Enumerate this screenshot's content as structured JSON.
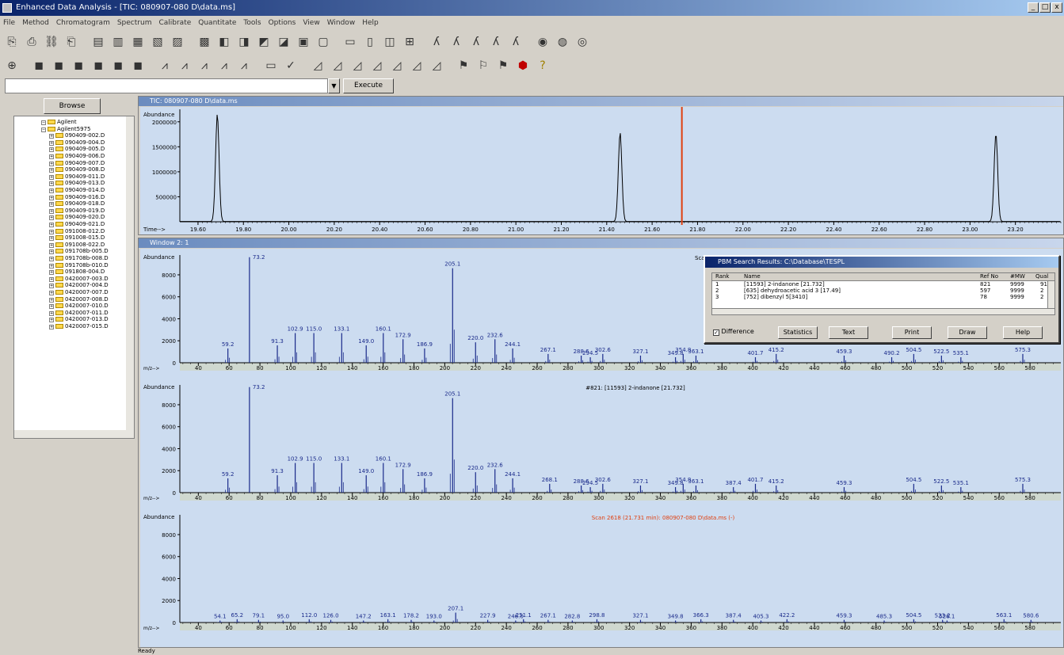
{
  "window": {
    "title": "Enhanced Data Analysis - [TIC: 080907-080 D\\data.ms]",
    "controls": [
      "_",
      "□",
      "x"
    ]
  },
  "menu": [
    "File",
    "Method",
    "Chromatogram",
    "Spectrum",
    "Calibrate",
    "Quantitate",
    "Tools",
    "Options",
    "View",
    "Window",
    "Help"
  ],
  "toolbar1_icons": [
    "load-icon",
    "save-icon",
    "link-icon",
    "print-icon",
    "chrom-icon",
    "spec-icon",
    "integrate-icon",
    "library-icon",
    "tune-icon",
    "report-icon",
    "peak-icon",
    "calib-icon",
    "qual-icon",
    "quant-icon",
    "table-icon",
    "doc-icon",
    "signal-icon",
    "window-icon",
    "overlay-icon",
    "zoom-icon",
    "a1-icon",
    "a2-icon",
    "a3-icon",
    "a4-icon",
    "a5-icon",
    "sync-icon",
    "globe-icon",
    "network-icon"
  ],
  "toolbar2_icons": [
    "target-icon",
    "b1-icon",
    "b2-icon",
    "b3-icon",
    "b4-icon",
    "b5-icon",
    "b6-icon",
    "scale1-icon",
    "scale2-icon",
    "peak1-icon",
    "peak2-icon",
    "peak3-icon",
    "frame-icon",
    "check-icon",
    "chart1-icon",
    "chart2-icon",
    "chart3-icon",
    "chart4-icon",
    "chart5-icon",
    "chart6-icon",
    "chart7-icon",
    "flag-icon",
    "flag2-icon",
    "flag3-icon",
    "stop-icon",
    "help-icon"
  ],
  "command": {
    "value": "",
    "execute": "Execute"
  },
  "browse": {
    "label": "Browse"
  },
  "tree": {
    "items": [
      "Agilent",
      "Agilent5975",
      "090409-002.D",
      "090409-004.D",
      "090409-005.D",
      "090409-006.D",
      "090409-007.D",
      "090409-008.D",
      "090409-011.D",
      "090409-013.D",
      "090409-014.D",
      "090409-016.D",
      "090409-018.D",
      "090409-019.D",
      "090409-020.D",
      "090409-021.D",
      "091008-012.D",
      "091008-015.D",
      "091008-022.D",
      "091708b-005.D",
      "091708b-008.D",
      "091708b-010.D",
      "091808-004.D",
      "0420007-003.D",
      "0420007-004.D",
      "0420007-007.D",
      "0420007-008.D",
      "0420007-010.D",
      "0420007-011.D",
      "0420007-013.D",
      "0420007-015.D"
    ]
  },
  "tic_window": {
    "title": "TIC: 080907-080 D\\data.ms"
  },
  "tic": {
    "ylabel": "Abundance",
    "xlabel": "Time-->",
    "ytick_labels": [
      "2000000",
      "1500000",
      "1000000",
      "500000"
    ],
    "xtick_labels": [
      "19.60",
      "19.80",
      "20.00",
      "20.20",
      "20.40",
      "20.60",
      "20.80",
      "21.00",
      "21.20",
      "21.40",
      "21.60",
      "21.80",
      "22.00",
      "22.20",
      "22.40",
      "22.60",
      "22.80",
      "23.00",
      "23.20"
    ],
    "marker_color": "#e04010"
  },
  "spec_window": {
    "title": "Window 2: 1"
  },
  "spectra": [
    {
      "ylabel": "Abundance",
      "xlabel": "m/z-->",
      "header": "Scan 2598 (21.731 min): 080907-080 D\\data.ms",
      "header_color": "#000000",
      "base_peak_label": "73.2",
      "labels": [
        "59.2",
        "91.3",
        "102.9",
        "115.0",
        "133.1",
        "149.0",
        "160.1",
        "172.9",
        "186.9",
        "205.1",
        "220.0",
        "232.6",
        "244.1",
        "267.1",
        "288.6",
        "294.5",
        "302.6",
        "327.1",
        "349.8",
        "354.8",
        "363.1",
        "401.7",
        "415.2",
        "459.3",
        "490.2",
        "504.5",
        "522.5",
        "535.1",
        "575.3"
      ]
    },
    {
      "ylabel": "Abundance",
      "xlabel": "m/z-->",
      "header": "#821: [11593] 2-indanone [21.732]",
      "header_color": "#000000",
      "base_peak_label": "73.2",
      "labels": [
        "59.2",
        "91.3",
        "102.9",
        "115.0",
        "133.1",
        "149.0",
        "160.1",
        "172.9",
        "186.9",
        "205.1",
        "220.0",
        "232.6",
        "244.1",
        "268.1",
        "288.6",
        "294.5",
        "302.6",
        "327.1",
        "349.8",
        "354.8",
        "363.1",
        "387.4",
        "401.7",
        "415.2",
        "459.3",
        "504.5",
        "522.5",
        "535.1",
        "575.3"
      ]
    },
    {
      "ylabel": "Abundance",
      "xlabel": "m/z-->",
      "header": "Scan 2618 (21.731 min): 080907-080 D\\data.ms (-)",
      "header_color": "#e04010",
      "base_peak_label": "",
      "labels": [
        "54.1",
        "65.2",
        "79.1",
        "95.0",
        "112.0",
        "126.0",
        "147.2",
        "163.1",
        "178.2",
        "193.0",
        "207.1",
        "227.9",
        "246.0",
        "251.1",
        "267.1",
        "282.8",
        "298.8",
        "327.1",
        "349.8",
        "366.3",
        "387.4",
        "405.3",
        "422.2",
        "459.3",
        "485.3",
        "504.5",
        "523.2",
        "526.1",
        "563.1",
        "580.6"
      ]
    }
  ],
  "spec_ytick_labels": [
    "8000",
    "6000",
    "4000",
    "2000"
  ],
  "spec_xtick_labels": [
    "40",
    "60",
    "80",
    "100",
    "120",
    "140",
    "160",
    "180",
    "200",
    "220",
    "240",
    "260",
    "280",
    "300",
    "320",
    "340",
    "360",
    "380",
    "400",
    "420",
    "440",
    "460",
    "480",
    "500",
    "520",
    "540",
    "560",
    "580"
  ],
  "dialog": {
    "title": "PBM Search Results: C:\\Database\\TESPL",
    "headers": [
      "Rank",
      "Name",
      "Ref No",
      "#MW",
      "Qual"
    ],
    "rows": [
      {
        "rank": "1",
        "name": "[11593] 2-indanone [21.732]",
        "ref": "821",
        "mw": "9999",
        "qual": "91"
      },
      {
        "rank": "2",
        "name": "[635] dehydroacetic acid 3 [17.49]",
        "ref": "597",
        "mw": "9999",
        "qual": "2"
      },
      {
        "rank": "3",
        "name": "[752] dibenzyl 5[3410]",
        "ref": "78",
        "mw": "9999",
        "qual": "2"
      }
    ],
    "difference_label": "Difference",
    "buttons": [
      "Statistics",
      "Text",
      "Print",
      "Draw",
      "Help"
    ]
  },
  "status": {
    "text": "Ready"
  }
}
